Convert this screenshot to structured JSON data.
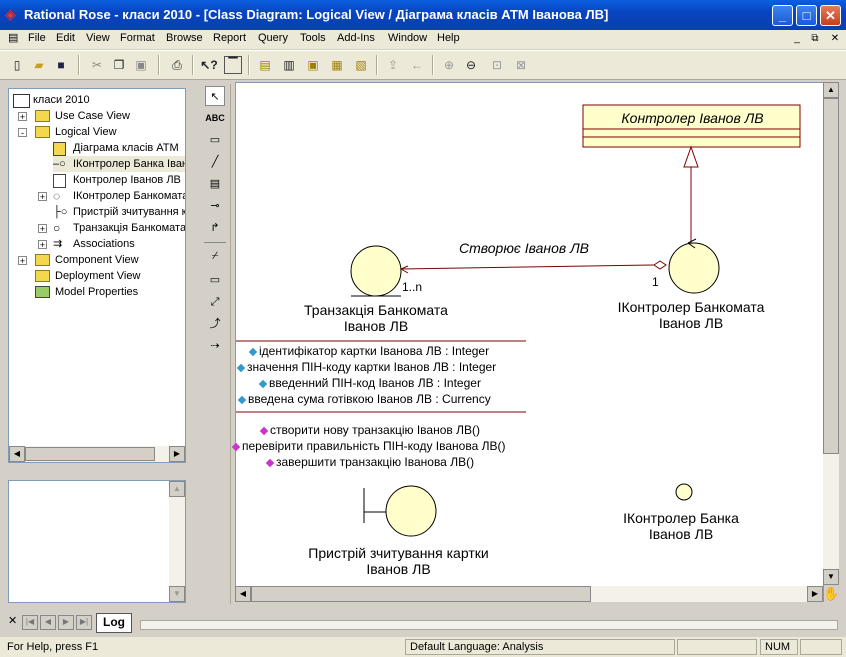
{
  "window": {
    "title": "Rational Rose - класи 2010 - [Class Diagram: Logical View / Діаграма класів АТМ Іванова ЛВ]",
    "minimize": "_",
    "maximize": "□",
    "close": "✕"
  },
  "menu": [
    "File",
    "Edit",
    "View",
    "Format",
    "Browse",
    "Report",
    "Query",
    "Tools",
    "Add-Ins",
    "Window",
    "Help"
  ],
  "mdi_controls": [
    "_",
    "⧉",
    "✕"
  ],
  "toolbar_icons": [
    "new-icon",
    "open-icon",
    "save-icon",
    "cut-icon",
    "copy-icon",
    "paste-icon",
    "print-icon",
    "context-help-icon",
    "view-doc-icon",
    "browse-class-icon",
    "browse-interaction-icon",
    "browse-component-icon",
    "browse-deployment-icon",
    "browse-parent-icon",
    "browse-previous-icon",
    "zoom-in-icon",
    "zoom-out-icon",
    "fit-window-icon",
    "undo-fit-icon"
  ],
  "tree": {
    "root": "класи 2010",
    "items": [
      {
        "label": "Use Case View",
        "level": 1,
        "expander": "+"
      },
      {
        "label": "Logical View",
        "level": 1,
        "expander": "-"
      },
      {
        "label": "Діаграма класів АТМ",
        "level": 2,
        "expander": ""
      },
      {
        "label": "ІКонтролер Банка Іван",
        "level": 2,
        "expander": ""
      },
      {
        "label": "Контролер Іванов ЛВ",
        "level": 2,
        "expander": ""
      },
      {
        "label": "ІКонтролер Банкомата",
        "level": 2,
        "expander": "+"
      },
      {
        "label": "Пристрій зчитування к",
        "level": 2,
        "expander": ""
      },
      {
        "label": "Транзакція Банкомата",
        "level": 2,
        "expander": "+"
      },
      {
        "label": "Associations",
        "level": 2,
        "expander": "+"
      },
      {
        "label": "Component View",
        "level": 1,
        "expander": "+"
      },
      {
        "label": "Deployment View",
        "level": 1,
        "expander": ""
      },
      {
        "label": "Model Properties",
        "level": 1,
        "expander": ""
      }
    ]
  },
  "palette": [
    "↖",
    "ABC",
    "▭",
    "╱",
    "▤",
    "⊸",
    "↱",
    "⌿",
    "▭",
    "⤢",
    "⤴",
    "⇢"
  ],
  "diagram": {
    "controller_class": "Контролер Іванов ЛВ",
    "association_label": "Створює Іванов ЛВ",
    "mult_target": "1..n",
    "mult_source": "1",
    "transaction_name_1": "Транзакція Банкомата",
    "transaction_name_2": "Іванов ЛВ",
    "atm_controller_name_1": "ІКонтролер Банкомата",
    "atm_controller_name_2": "Іванов ЛВ",
    "attributes": [
      "ідентифікатор картки Іванова ЛВ : Integer",
      "значення ПІН-коду картки Іванов ЛВ : Integer",
      "введенний ПІН-код Іванов ЛВ : Integer",
      "введена сума готівкою Іванов ЛВ : Currency"
    ],
    "operations": [
      "створити нову транзакцію Іванов ЛВ()",
      "перевірити правильність ПІН-коду  Іванова ЛВ()",
      "завершити транзакцію Іванова ЛВ()"
    ],
    "reader_name_1": "Пристрій зчитування картки",
    "reader_name_2": "Іванов ЛВ",
    "bank_controller_name_1": "ІКонтролер Банка",
    "bank_controller_name_2": "Іванов ЛВ"
  },
  "tabs": {
    "log": "Log"
  },
  "status": {
    "help": "For Help, press F1",
    "language": "Default Language: Analysis",
    "num": "NUM"
  },
  "colors": {
    "class_fill": "#ffffcc",
    "class_border": "#800000",
    "association": "#800000",
    "attr_diamond": "#3399cc",
    "op_diamond": "#cc33cc"
  }
}
